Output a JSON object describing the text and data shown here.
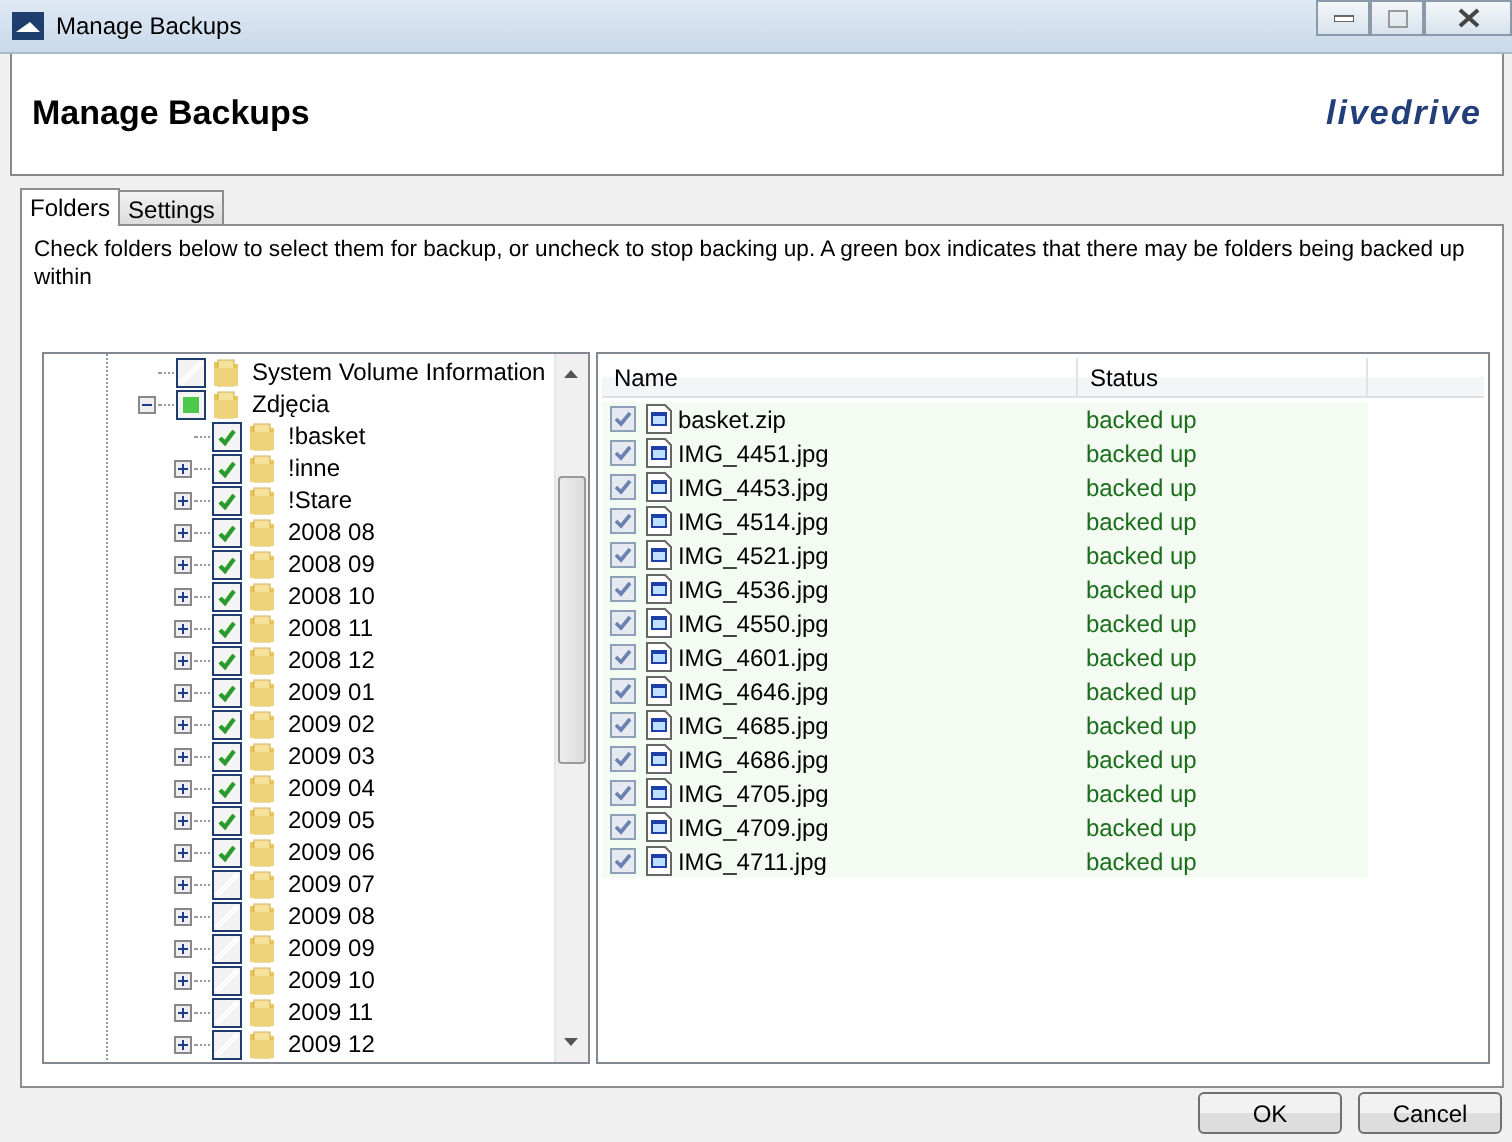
{
  "window": {
    "title": "Manage Backups"
  },
  "header": {
    "title": "Manage Backups",
    "logo": "livedrive"
  },
  "tabs": [
    {
      "label": "Folders",
      "selected": true
    },
    {
      "label": "Settings",
      "selected": false
    }
  ],
  "description": "Check folders below to select them for backup, or uncheck to stop backing up. A green box indicates that there may be folders being backed up within",
  "tree": {
    "items": [
      {
        "label": "System Volume Information",
        "checked": false,
        "partial": false
      },
      {
        "label": "Zdjęcia",
        "checked": false,
        "partial": true,
        "expanded": true,
        "children": [
          {
            "label": "!basket",
            "checked": true,
            "partial": false
          },
          {
            "label": "!inne",
            "checked": true,
            "partial": false,
            "expanded": false
          },
          {
            "label": "!Stare",
            "checked": true,
            "partial": false,
            "expanded": false
          },
          {
            "label": "2008 08",
            "checked": true,
            "partial": false,
            "expanded": false
          },
          {
            "label": "2008 09",
            "checked": true,
            "partial": false,
            "expanded": false
          },
          {
            "label": "2008 10",
            "checked": true,
            "partial": false,
            "expanded": false
          },
          {
            "label": "2008 11",
            "checked": true,
            "partial": false,
            "expanded": false
          },
          {
            "label": "2008 12",
            "checked": true,
            "partial": false,
            "expanded": false
          },
          {
            "label": "2009 01",
            "checked": true,
            "partial": false,
            "expanded": false
          },
          {
            "label": "2009 02",
            "checked": true,
            "partial": false,
            "expanded": false
          },
          {
            "label": "2009 03",
            "checked": true,
            "partial": false,
            "expanded": false
          },
          {
            "label": "2009 04",
            "checked": true,
            "partial": false,
            "expanded": false
          },
          {
            "label": "2009 05",
            "checked": true,
            "partial": false,
            "expanded": false
          },
          {
            "label": "2009 06",
            "checked": true,
            "partial": false,
            "expanded": false
          },
          {
            "label": "2009 07",
            "checked": false,
            "partial": false,
            "expanded": false
          },
          {
            "label": "2009 08",
            "checked": false,
            "partial": false,
            "expanded": false
          },
          {
            "label": "2009 09",
            "checked": false,
            "partial": false,
            "expanded": false
          },
          {
            "label": "2009 10",
            "checked": false,
            "partial": false,
            "expanded": false
          },
          {
            "label": "2009 11",
            "checked": false,
            "partial": false,
            "expanded": false
          },
          {
            "label": "2009 12",
            "checked": false,
            "partial": false,
            "expanded": false
          }
        ]
      }
    ]
  },
  "files": {
    "columns": [
      "Name",
      "Status"
    ],
    "rows": [
      {
        "checked": true,
        "name": "basket.zip",
        "status": "backed up"
      },
      {
        "checked": true,
        "name": "IMG_4451.jpg",
        "status": "backed up"
      },
      {
        "checked": true,
        "name": "IMG_4453.jpg",
        "status": "backed up"
      },
      {
        "checked": true,
        "name": "IMG_4514.jpg",
        "status": "backed up"
      },
      {
        "checked": true,
        "name": "IMG_4521.jpg",
        "status": "backed up"
      },
      {
        "checked": true,
        "name": "IMG_4536.jpg",
        "status": "backed up"
      },
      {
        "checked": true,
        "name": "IMG_4550.jpg",
        "status": "backed up"
      },
      {
        "checked": true,
        "name": "IMG_4601.jpg",
        "status": "backed up"
      },
      {
        "checked": true,
        "name": "IMG_4646.jpg",
        "status": "backed up"
      },
      {
        "checked": true,
        "name": "IMG_4685.jpg",
        "status": "backed up"
      },
      {
        "checked": true,
        "name": "IMG_4686.jpg",
        "status": "backed up"
      },
      {
        "checked": true,
        "name": "IMG_4705.jpg",
        "status": "backed up"
      },
      {
        "checked": true,
        "name": "IMG_4709.jpg",
        "status": "backed up"
      },
      {
        "checked": true,
        "name": "IMG_4711.jpg",
        "status": "backed up"
      }
    ]
  },
  "buttons": [
    "OK",
    "Cancel"
  ]
}
